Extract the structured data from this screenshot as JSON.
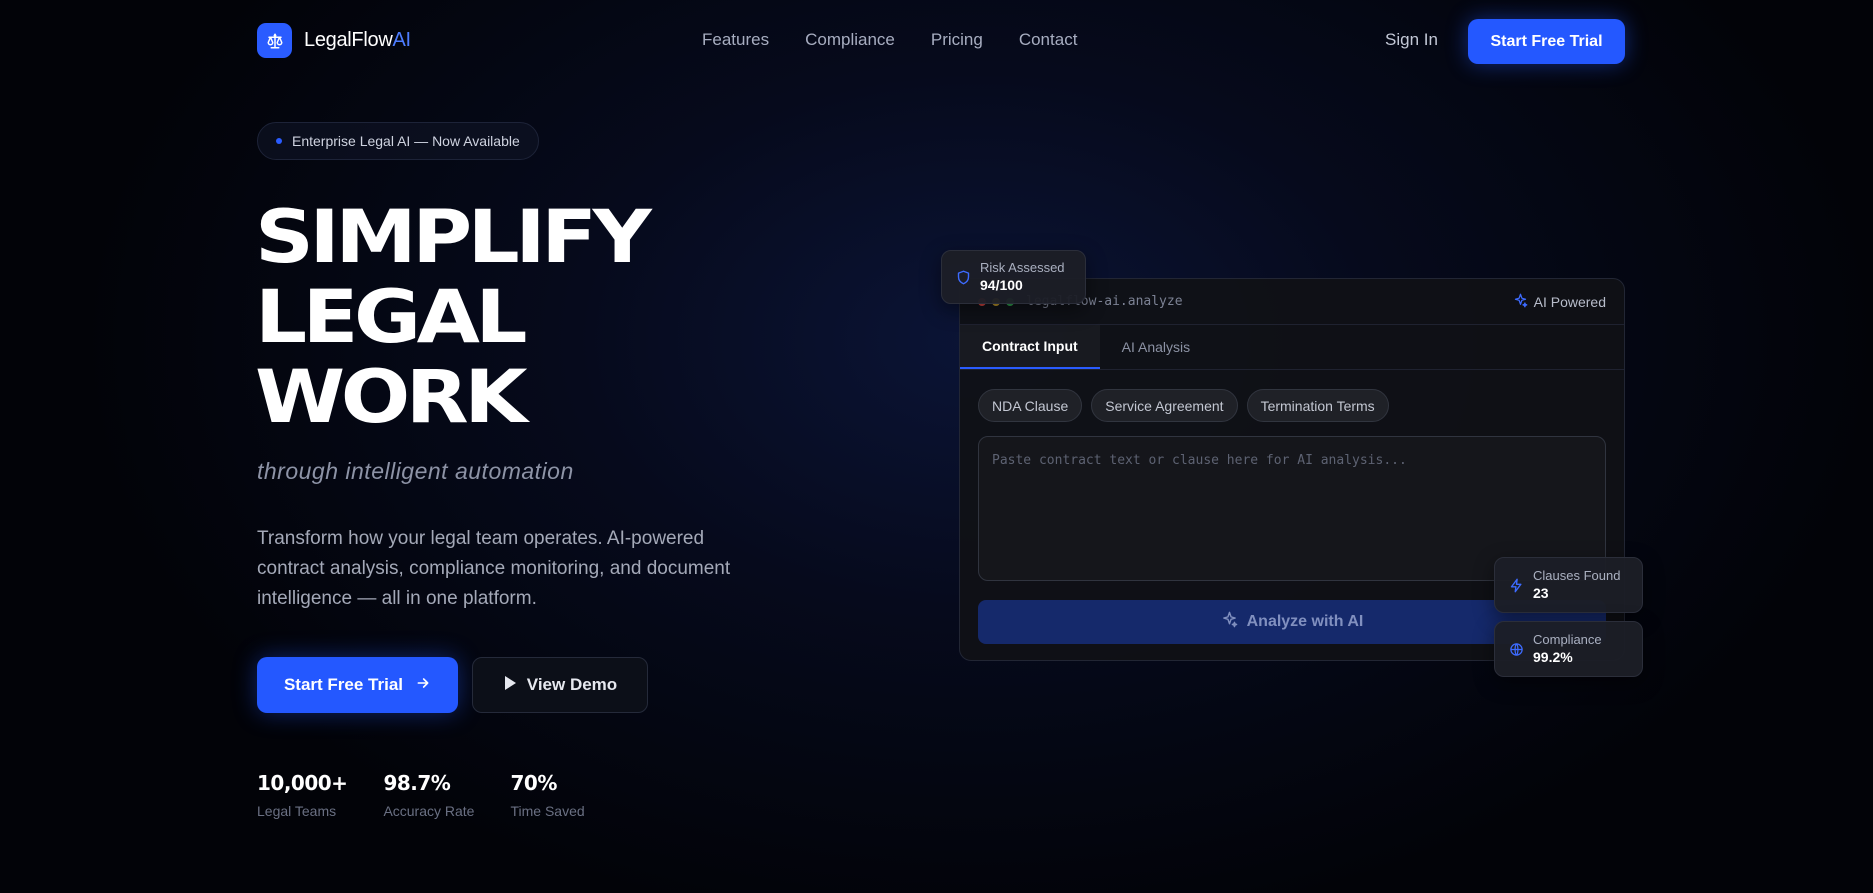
{
  "nav": {
    "logo_text": "LegalFlow",
    "logo_accent": "AI",
    "links": [
      "Features",
      "Compliance",
      "Pricing",
      "Contact"
    ],
    "sign_in": "Sign In",
    "cta": "Start Free Trial"
  },
  "hero": {
    "badge": "Enterprise Legal AI — Now Available",
    "headline": [
      "SIMPLIFY",
      "LEGAL",
      "WORK"
    ],
    "subhead": "through intelligent automation",
    "description": "Transform how your legal team operates. AI-powered contract analysis, compliance monitoring, and document intelligence — all in one platform.",
    "primary_cta": "Start Free Trial",
    "secondary_cta": "View Demo",
    "stats": [
      {
        "value": "10,000+",
        "label": "Legal Teams"
      },
      {
        "value": "98.7%",
        "label": "Accuracy Rate"
      },
      {
        "value": "70%",
        "label": "Time Saved"
      }
    ]
  },
  "panel": {
    "path": "legalflow-ai.analyze",
    "ai_badge": "AI Powered",
    "tabs": [
      "Contract Input",
      "AI Analysis"
    ],
    "active_tab": "Contract Input",
    "chips": [
      "NDA Clause",
      "Service Agreement",
      "Termination Terms"
    ],
    "placeholder": "Paste contract text or clause here for AI analysis...",
    "analyze_button": "Analyze with AI"
  },
  "floating_cards": {
    "risk": {
      "label": "Risk Assessed",
      "value": "94/100",
      "icon": "shield-icon"
    },
    "clauses": {
      "label": "Clauses Found",
      "value": "23",
      "icon": "bolt-icon"
    },
    "compliance": {
      "label": "Compliance",
      "value": "99.2%",
      "icon": "globe-icon"
    }
  },
  "colors": {
    "accent": "#2458ff",
    "background": "#05070f"
  }
}
